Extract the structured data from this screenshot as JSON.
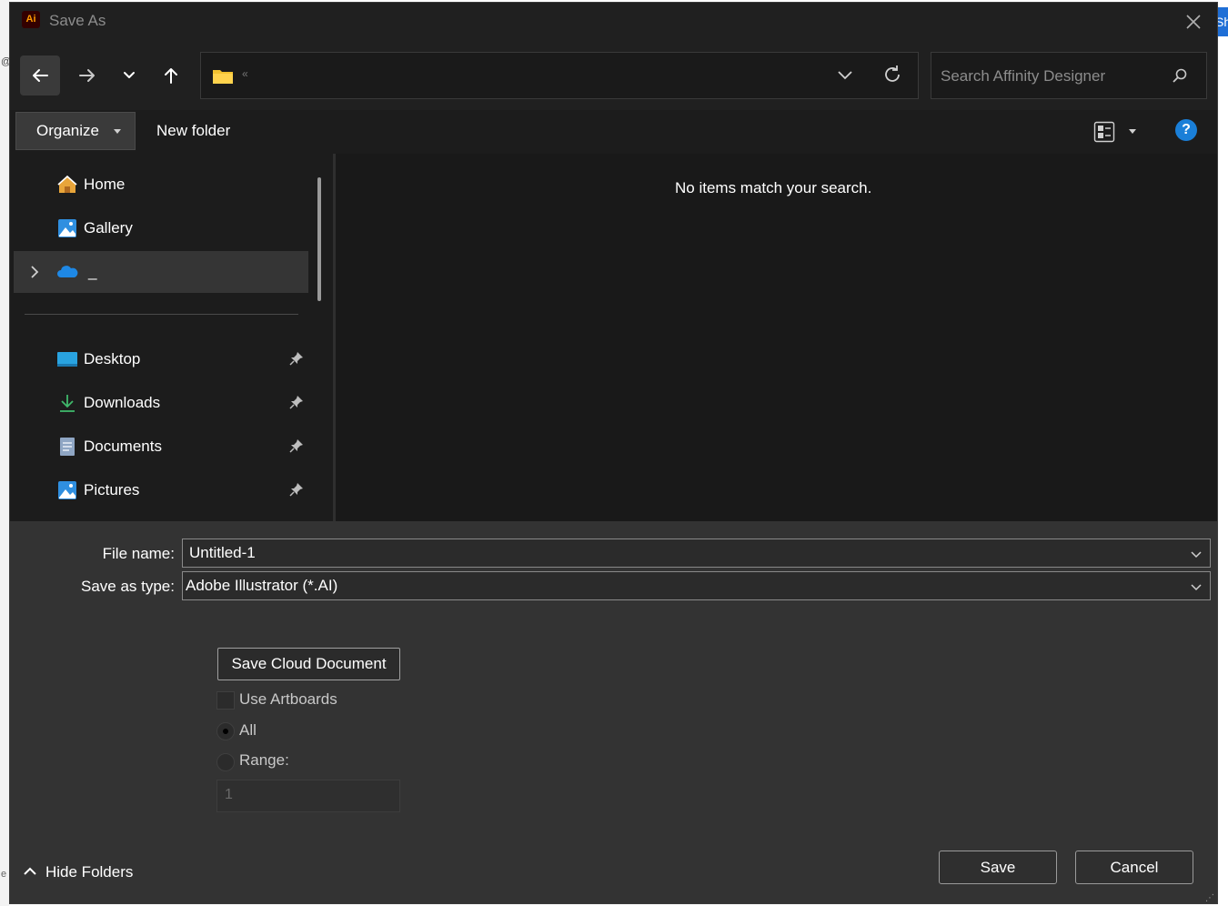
{
  "window": {
    "title": "Save As",
    "app_icon_text": "Ai"
  },
  "background": {
    "right_button_text": "Sh"
  },
  "nav": {
    "address_text": "«",
    "search_placeholder": "Search Affinity Designer"
  },
  "toolbar": {
    "organize_label": "Organize",
    "new_folder_label": "New folder",
    "help_label": "?"
  },
  "sidebar": {
    "quick": [
      {
        "label": "Home",
        "icon": "home-icon"
      },
      {
        "label": "Gallery",
        "icon": "gallery-icon"
      },
      {
        "label": "_",
        "icon": "onedrive-cloud-icon",
        "selected": true
      }
    ],
    "pinned": [
      {
        "label": "Desktop",
        "icon": "desktop-icon",
        "pinned": true
      },
      {
        "label": "Downloads",
        "icon": "downloads-icon",
        "pinned": true
      },
      {
        "label": "Documents",
        "icon": "documents-icon",
        "pinned": true
      },
      {
        "label": "Pictures",
        "icon": "pictures-icon",
        "pinned": true
      }
    ]
  },
  "content": {
    "empty_message": "No items match your search."
  },
  "form": {
    "file_name_label": "File name:",
    "file_name_value": "Untitled-1",
    "save_type_label": "Save as type:",
    "save_type_value": "Adobe Illustrator (*.AI)",
    "cloud_button": "Save Cloud Document",
    "use_artboards_label": "Use Artboards",
    "use_artboards_checked": false,
    "all_label": "All",
    "all_selected": true,
    "range_label": "Range:",
    "range_value": "1"
  },
  "footer": {
    "hide_folders_label": "Hide Folders",
    "save_label": "Save",
    "cancel_label": "Cancel"
  },
  "colors": {
    "accent": "#1a7fd8",
    "dialog_bg": "#202020",
    "panel_bg": "#333333"
  }
}
